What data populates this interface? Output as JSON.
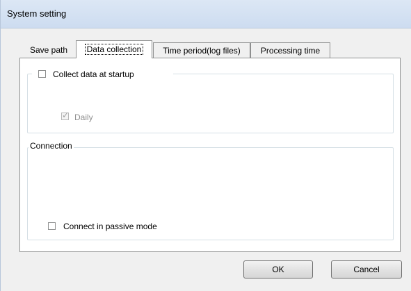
{
  "window": {
    "title": "System setting"
  },
  "tabs": [
    {
      "label": "Save path",
      "active": false
    },
    {
      "label": "Data collection",
      "active": true
    },
    {
      "label": "Time period(log files)",
      "active": false
    },
    {
      "label": "Processing time",
      "active": false
    }
  ],
  "collect_group": {
    "checkbox_label": "Collect data at startup",
    "checked": false,
    "daily_label": "Daily",
    "daily_checked": true,
    "daily_enabled": false
  },
  "connection_group": {
    "title": "Connection",
    "passive_label": "Connect in passive mode",
    "passive_checked": false
  },
  "buttons": {
    "ok": "OK",
    "cancel": "Cancel"
  },
  "icons": {
    "checkmark": "checkmark-icon"
  }
}
